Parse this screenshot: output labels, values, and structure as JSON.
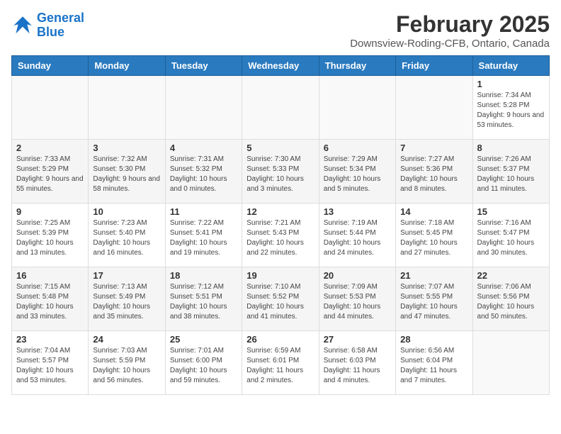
{
  "header": {
    "logo_line1": "General",
    "logo_line2": "Blue",
    "main_title": "February 2025",
    "sub_title": "Downsview-Roding-CFB, Ontario, Canada"
  },
  "weekdays": [
    "Sunday",
    "Monday",
    "Tuesday",
    "Wednesday",
    "Thursday",
    "Friday",
    "Saturday"
  ],
  "weeks": [
    [
      {
        "day": "",
        "info": ""
      },
      {
        "day": "",
        "info": ""
      },
      {
        "day": "",
        "info": ""
      },
      {
        "day": "",
        "info": ""
      },
      {
        "day": "",
        "info": ""
      },
      {
        "day": "",
        "info": ""
      },
      {
        "day": "1",
        "info": "Sunrise: 7:34 AM\nSunset: 5:28 PM\nDaylight: 9 hours and 53 minutes."
      }
    ],
    [
      {
        "day": "2",
        "info": "Sunrise: 7:33 AM\nSunset: 5:29 PM\nDaylight: 9 hours and 55 minutes."
      },
      {
        "day": "3",
        "info": "Sunrise: 7:32 AM\nSunset: 5:30 PM\nDaylight: 9 hours and 58 minutes."
      },
      {
        "day": "4",
        "info": "Sunrise: 7:31 AM\nSunset: 5:32 PM\nDaylight: 10 hours and 0 minutes."
      },
      {
        "day": "5",
        "info": "Sunrise: 7:30 AM\nSunset: 5:33 PM\nDaylight: 10 hours and 3 minutes."
      },
      {
        "day": "6",
        "info": "Sunrise: 7:29 AM\nSunset: 5:34 PM\nDaylight: 10 hours and 5 minutes."
      },
      {
        "day": "7",
        "info": "Sunrise: 7:27 AM\nSunset: 5:36 PM\nDaylight: 10 hours and 8 minutes."
      },
      {
        "day": "8",
        "info": "Sunrise: 7:26 AM\nSunset: 5:37 PM\nDaylight: 10 hours and 11 minutes."
      }
    ],
    [
      {
        "day": "9",
        "info": "Sunrise: 7:25 AM\nSunset: 5:39 PM\nDaylight: 10 hours and 13 minutes."
      },
      {
        "day": "10",
        "info": "Sunrise: 7:23 AM\nSunset: 5:40 PM\nDaylight: 10 hours and 16 minutes."
      },
      {
        "day": "11",
        "info": "Sunrise: 7:22 AM\nSunset: 5:41 PM\nDaylight: 10 hours and 19 minutes."
      },
      {
        "day": "12",
        "info": "Sunrise: 7:21 AM\nSunset: 5:43 PM\nDaylight: 10 hours and 22 minutes."
      },
      {
        "day": "13",
        "info": "Sunrise: 7:19 AM\nSunset: 5:44 PM\nDaylight: 10 hours and 24 minutes."
      },
      {
        "day": "14",
        "info": "Sunrise: 7:18 AM\nSunset: 5:45 PM\nDaylight: 10 hours and 27 minutes."
      },
      {
        "day": "15",
        "info": "Sunrise: 7:16 AM\nSunset: 5:47 PM\nDaylight: 10 hours and 30 minutes."
      }
    ],
    [
      {
        "day": "16",
        "info": "Sunrise: 7:15 AM\nSunset: 5:48 PM\nDaylight: 10 hours and 33 minutes."
      },
      {
        "day": "17",
        "info": "Sunrise: 7:13 AM\nSunset: 5:49 PM\nDaylight: 10 hours and 35 minutes."
      },
      {
        "day": "18",
        "info": "Sunrise: 7:12 AM\nSunset: 5:51 PM\nDaylight: 10 hours and 38 minutes."
      },
      {
        "day": "19",
        "info": "Sunrise: 7:10 AM\nSunset: 5:52 PM\nDaylight: 10 hours and 41 minutes."
      },
      {
        "day": "20",
        "info": "Sunrise: 7:09 AM\nSunset: 5:53 PM\nDaylight: 10 hours and 44 minutes."
      },
      {
        "day": "21",
        "info": "Sunrise: 7:07 AM\nSunset: 5:55 PM\nDaylight: 10 hours and 47 minutes."
      },
      {
        "day": "22",
        "info": "Sunrise: 7:06 AM\nSunset: 5:56 PM\nDaylight: 10 hours and 50 minutes."
      }
    ],
    [
      {
        "day": "23",
        "info": "Sunrise: 7:04 AM\nSunset: 5:57 PM\nDaylight: 10 hours and 53 minutes."
      },
      {
        "day": "24",
        "info": "Sunrise: 7:03 AM\nSunset: 5:59 PM\nDaylight: 10 hours and 56 minutes."
      },
      {
        "day": "25",
        "info": "Sunrise: 7:01 AM\nSunset: 6:00 PM\nDaylight: 10 hours and 59 minutes."
      },
      {
        "day": "26",
        "info": "Sunrise: 6:59 AM\nSunset: 6:01 PM\nDaylight: 11 hours and 2 minutes."
      },
      {
        "day": "27",
        "info": "Sunrise: 6:58 AM\nSunset: 6:03 PM\nDaylight: 11 hours and 4 minutes."
      },
      {
        "day": "28",
        "info": "Sunrise: 6:56 AM\nSunset: 6:04 PM\nDaylight: 11 hours and 7 minutes."
      },
      {
        "day": "",
        "info": ""
      }
    ]
  ]
}
